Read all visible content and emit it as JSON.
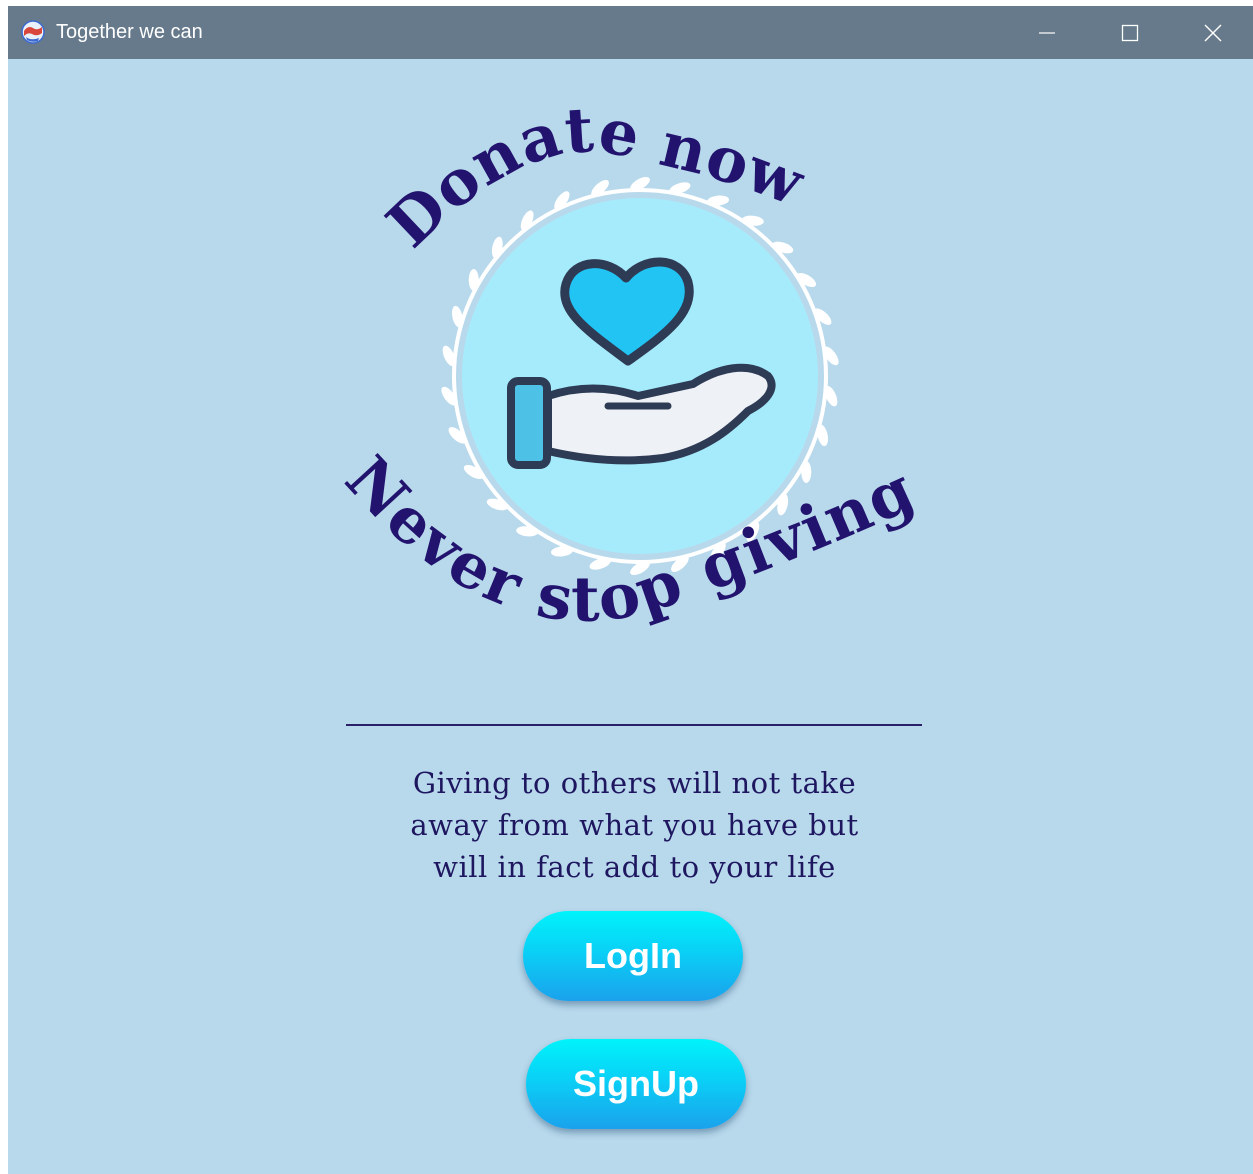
{
  "window": {
    "title": "Together we can",
    "icon": "app-globe-icon",
    "controls": [
      "minimize-icon",
      "maximize-icon",
      "close-icon"
    ]
  },
  "logo": {
    "top_text": "Donate now",
    "bottom_text": "Never stop giving",
    "icon": "heart-in-hand-icon"
  },
  "quote": {
    "lines": [
      "Giving to others will not take",
      "away from what you have but",
      "will in fact add to your life"
    ]
  },
  "buttons": {
    "login_label": "LogIn",
    "signup_label": "SignUp"
  },
  "colors": {
    "background": "#b8d9ec",
    "titlebar": "#667a8b",
    "text_dark": "#1e1760",
    "button_top": "#00f3fb",
    "button_bottom": "#1aa2ec"
  }
}
